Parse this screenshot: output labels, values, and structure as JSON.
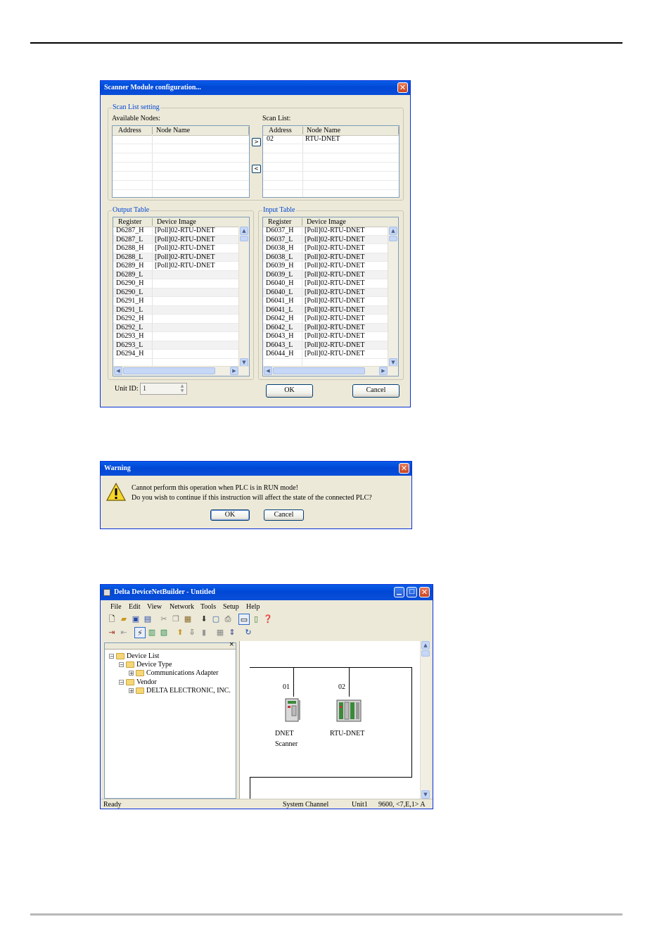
{
  "scanner": {
    "title": "Scanner Module configuration...",
    "scan_group": "Scan List setting",
    "available_label": "Available Nodes:",
    "scanlist_label": "Scan List:",
    "col_address": "Address",
    "col_node_name": "Node Name",
    "add_btn": ">",
    "remove_btn": "<",
    "scan_list": [
      {
        "address": "02",
        "name": "RTU-DNET"
      }
    ],
    "output_group": "Output Table",
    "input_group": "Input Table",
    "col_register": "Register",
    "col_device_image": "Device Image",
    "output_rows": [
      {
        "reg": "D6287_H",
        "img": "[Poll]02-RTU-DNET"
      },
      {
        "reg": "D6287_L",
        "img": "[Poll]02-RTU-DNET"
      },
      {
        "reg": "D6288_H",
        "img": "[Poll]02-RTU-DNET"
      },
      {
        "reg": "D6288_L",
        "img": "[Poll]02-RTU-DNET"
      },
      {
        "reg": "D6289_H",
        "img": "[Poll]02-RTU-DNET"
      },
      {
        "reg": "D6289_L",
        "img": ""
      },
      {
        "reg": "D6290_H",
        "img": ""
      },
      {
        "reg": "D6290_L",
        "img": ""
      },
      {
        "reg": "D6291_H",
        "img": ""
      },
      {
        "reg": "D6291_L",
        "img": ""
      },
      {
        "reg": "D6292_H",
        "img": ""
      },
      {
        "reg": "D6292_L",
        "img": ""
      },
      {
        "reg": "D6293_H",
        "img": ""
      },
      {
        "reg": "D6293_L",
        "img": ""
      },
      {
        "reg": "D6294_H",
        "img": ""
      }
    ],
    "input_rows": [
      {
        "reg": "D6037_H",
        "img": "[Poll]02-RTU-DNET"
      },
      {
        "reg": "D6037_L",
        "img": "[Poll]02-RTU-DNET"
      },
      {
        "reg": "D6038_H",
        "img": "[Poll]02-RTU-DNET"
      },
      {
        "reg": "D6038_L",
        "img": "[Poll]02-RTU-DNET"
      },
      {
        "reg": "D6039_H",
        "img": "[Poll]02-RTU-DNET"
      },
      {
        "reg": "D6039_L",
        "img": "[Poll]02-RTU-DNET"
      },
      {
        "reg": "D6040_H",
        "img": "[Poll]02-RTU-DNET"
      },
      {
        "reg": "D6040_L",
        "img": "[Poll]02-RTU-DNET"
      },
      {
        "reg": "D6041_H",
        "img": "[Poll]02-RTU-DNET"
      },
      {
        "reg": "D6041_L",
        "img": "[Poll]02-RTU-DNET"
      },
      {
        "reg": "D6042_H",
        "img": "[Poll]02-RTU-DNET"
      },
      {
        "reg": "D6042_L",
        "img": "[Poll]02-RTU-DNET"
      },
      {
        "reg": "D6043_H",
        "img": "[Poll]02-RTU-DNET"
      },
      {
        "reg": "D6043_L",
        "img": "[Poll]02-RTU-DNET"
      },
      {
        "reg": "D6044_H",
        "img": "[Poll]02-RTU-DNET"
      }
    ],
    "unit_id_label": "Unit ID:",
    "unit_id_value": "1",
    "ok": "OK",
    "cancel": "Cancel"
  },
  "warning": {
    "title": "Warning",
    "line1": "Cannot perform this operation when PLC is in RUN mode!",
    "line2": "Do you wish to continue if this instruction will affect the state of the connected PLC?",
    "ok": "OK",
    "cancel": "Cancel"
  },
  "builder": {
    "title": "Delta DeviceNetBuilder - Untitled",
    "menu": [
      "File",
      "Edit",
      "View",
      "Network",
      "Tools",
      "Setup",
      "Help"
    ],
    "tree": {
      "root": "Device List",
      "device_type": "Device Type",
      "comm_adapter": "Communications Adapter",
      "vendor": "Vendor",
      "delta": "DELTA ELECTRONIC, INC."
    },
    "nodes": [
      {
        "address": "01",
        "label_line1": "DNET",
        "label_line2": "Scanner"
      },
      {
        "address": "02",
        "label_line1": "RTU-DNET",
        "label_line2": ""
      }
    ],
    "status": {
      "ready": "Ready",
      "channel": "System Channel",
      "unit": "Unit1",
      "comm": "9600, <7,E,1> A"
    }
  }
}
